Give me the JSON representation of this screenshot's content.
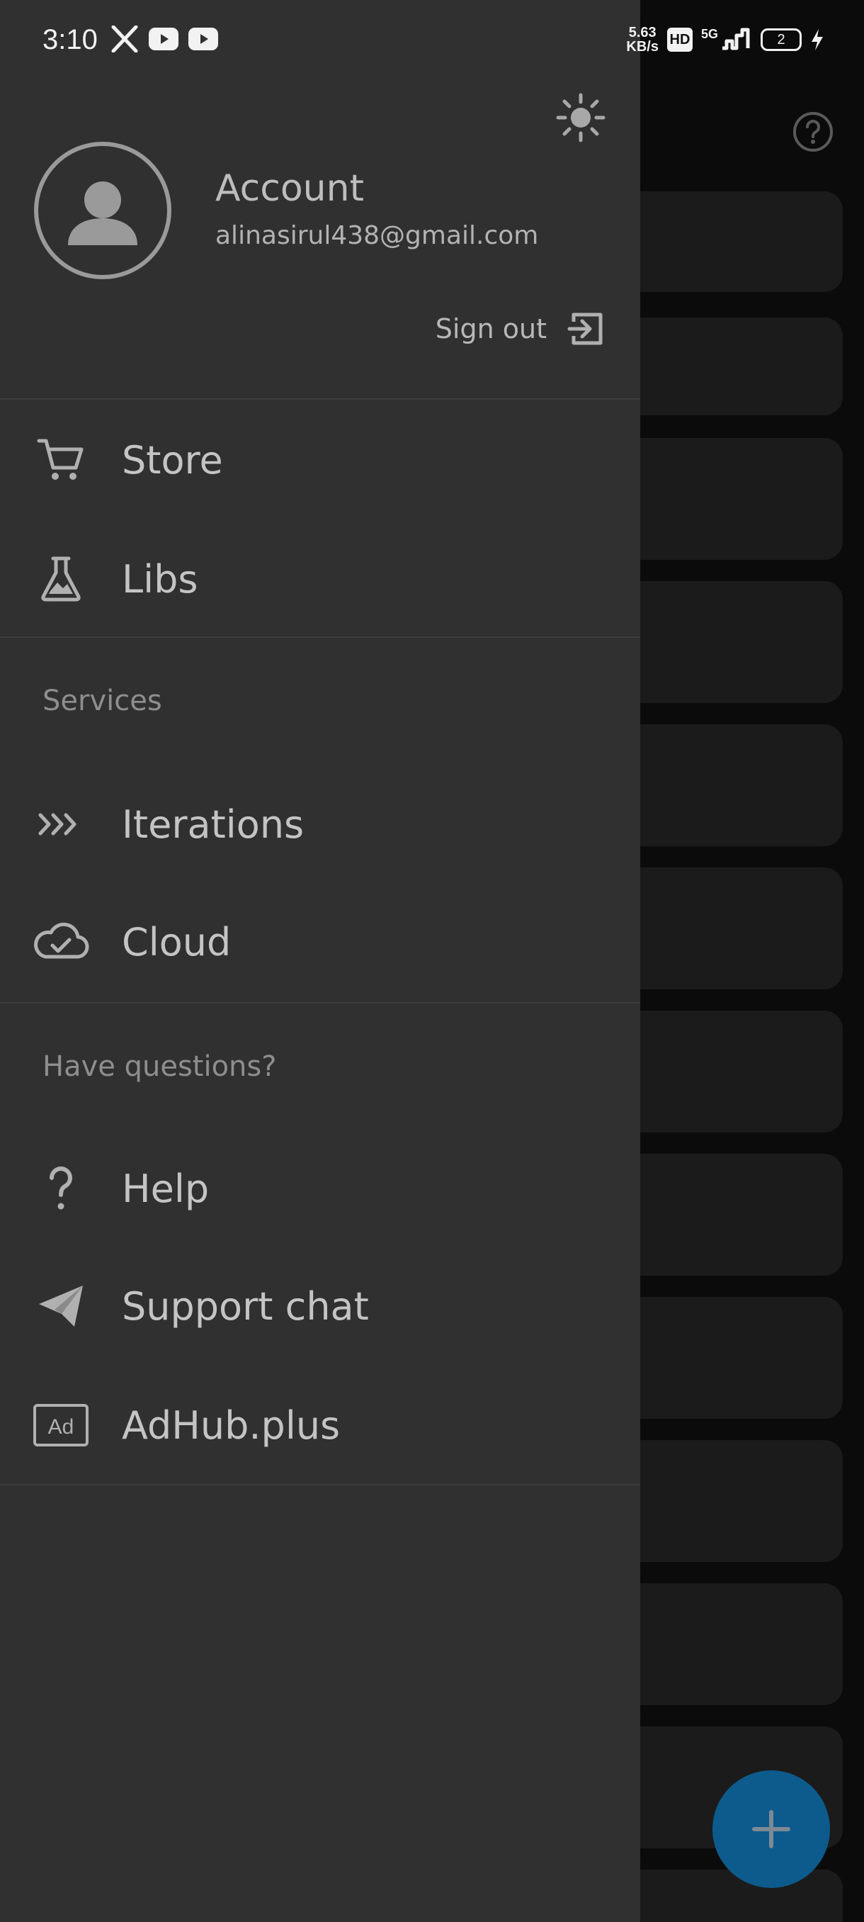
{
  "status_bar": {
    "time": "3:10",
    "net_speed_value": "5.63",
    "net_speed_unit": "KB/s",
    "hd_label": "HD",
    "network_label": "5G",
    "battery_level": "2",
    "notification_icons": [
      "x-icon",
      "youtube-icon",
      "youtube-icon"
    ]
  },
  "account": {
    "name": "Account",
    "email": "alinasirul438@gmail.com",
    "sign_out_label": "Sign out"
  },
  "menu": {
    "primary": [
      {
        "label": "Store",
        "icon": "cart-icon"
      },
      {
        "label": "Libs",
        "icon": "flask-icon"
      }
    ],
    "services_header": "Services",
    "services": [
      {
        "label": "Iterations",
        "icon": "chevrons-icon"
      },
      {
        "label": "Cloud",
        "icon": "cloud-check-icon"
      }
    ],
    "questions_header": "Have questions?",
    "questions": [
      {
        "label": "Help",
        "icon": "question-icon"
      },
      {
        "label": "Support chat",
        "icon": "send-icon"
      },
      {
        "label": "AdHub.plus",
        "icon": "ad-icon"
      }
    ]
  },
  "colors": {
    "drawer_bg": "#303030",
    "fab_bg": "#0d5a8c",
    "text": "#c4c4c4",
    "muted": "#8e8e8e"
  }
}
